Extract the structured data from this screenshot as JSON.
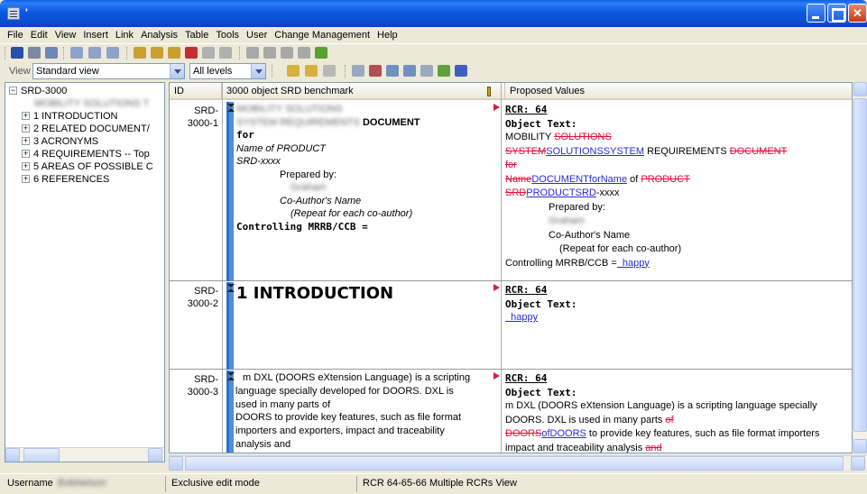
{
  "window": {
    "title": "'"
  },
  "menu": [
    "File",
    "Edit",
    "View",
    "Insert",
    "Link",
    "Analysis",
    "Table",
    "Tools",
    "User",
    "Change Management",
    "Help"
  ],
  "viewbar": {
    "label": "View",
    "view_value": "Standard view",
    "levels_value": "All levels"
  },
  "tree": {
    "root": "SRD-3000",
    "child_blurred": "MOBILITY SOLUTIONS T",
    "items": [
      "1 INTRODUCTION",
      "2 RELATED DOCUMENT/",
      "3 ACRONYMS",
      "4 REQUIREMENTS -- Top",
      "5 AREAS OF POSSIBLE C",
      "6 REFERENCES"
    ]
  },
  "grid": {
    "columns": [
      "ID",
      "3000 object SRD benchmark",
      "Proposed Values"
    ],
    "rows": [
      {
        "id_prefix": "SRD-",
        "id_num": "3000-1",
        "blur1": "MOBILITY SOLUTIONS",
        "blur2": "SYSTEM REQUIREMENTS",
        "doc": "DOCUMENT",
        "for": "for",
        "name": "Name of PRODUCT",
        "srd": "SRD-xxxx",
        "prepared": "Prepared by:",
        "blur_name": "Graham",
        "coauthor": "Co-Author's Name",
        "repeat": "(Repeat for each co-author)",
        "controlling": "Controlling MRRB/CCB =",
        "rcr": "RCR: 64",
        "object_text": "Object Text:",
        "p_mobility": "MOBILITY",
        "p_del_solutions": "SOLUTIONS",
        "p_del_system": "SYSTEM",
        "p_ins_solsys": "SOLUTIONSSYSTEM",
        "p_requirements": "REQUIREMENTS",
        "p_del_document": "DOCUMENT",
        "p_del_for": "for",
        "p_del_name": "Name",
        "p_ins_docfor": "DOCUMENTforName",
        "p_of": "of",
        "p_del_product": "PRODUCT",
        "p_del_srd": "SRD",
        "p_ins_prodsrd": "PRODUCTSRD",
        "p_xxxx": "-xxxx",
        "p_prepared": "Prepared by:",
        "p_blur_name": "Graham",
        "p_coauthor": "Co-Author's Name",
        "p_repeat": "(Repeat for each co-author)",
        "p_controlling": "Controlling MRRB/CCB =",
        "p_ins_happy": "  happy"
      },
      {
        "id_prefix": "SRD-",
        "id_num": "3000-2",
        "heading": "1 INTRODUCTION",
        "rcr": "RCR: 64",
        "object_text": "Object Text:",
        "p_ins_happy": "  happy"
      },
      {
        "id_prefix": "SRD-",
        "id_num": "3000-3",
        "l1": "m  DXL (DOORS eXtension Language) is a scripting",
        "l2": "language specially developed for DOORS. DXL is",
        "l3": "used in many parts of",
        "l4": "DOORS to provide key features, such as file format",
        "l5": "importers and exporters, impact and traceability",
        "l6": "analysis and",
        "rcr": "RCR: 64",
        "object_text": "Object Text:",
        "p_l1": "m  DXL (DOORS eXtension Language) is a scripting language specially",
        "p_l2a": "DOORS. DXL is used in many parts",
        "p_del_of": "of",
        "p_del_doors": "DOORS",
        "p_ins_ofdoors": "ofDOORS",
        "p_l3b": "to provide key features, such as file format importers",
        "p_l4a": "impact and traceability analysis",
        "p_del_and": "and"
      }
    ]
  },
  "status": {
    "username_label": "Username",
    "username_blur": "BobNelson",
    "mode": "Exclusive edit mode",
    "view": "RCR 64-65-66  Multiple RCRs View"
  }
}
